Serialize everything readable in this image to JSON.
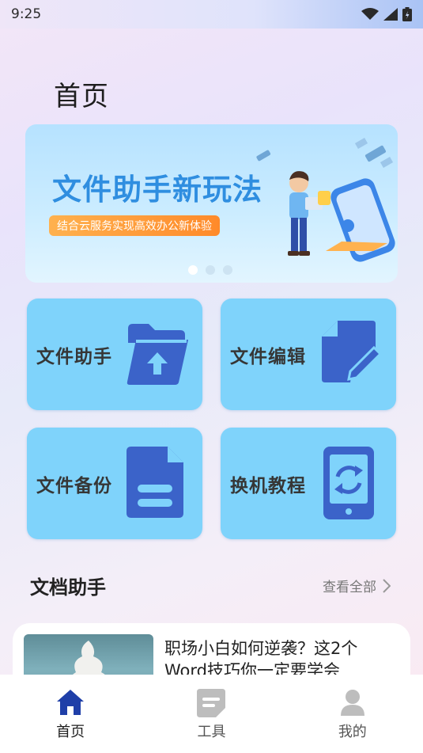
{
  "status_bar": {
    "time": "9:25"
  },
  "page": {
    "title": "首页"
  },
  "banner": {
    "title": "文件助手新玩法",
    "subtitle": "结合云服务实现高效办公新体验",
    "dots": 3,
    "active_dot": 0
  },
  "feature_cards": [
    {
      "label": "文件助手",
      "icon": "folder-upload-icon"
    },
    {
      "label": "文件编辑",
      "icon": "document-edit-icon"
    },
    {
      "label": "文件备份",
      "icon": "document-backup-icon"
    },
    {
      "label": "换机教程",
      "icon": "phone-sync-icon"
    }
  ],
  "section": {
    "title": "文档助手",
    "view_all": "查看全部"
  },
  "article": {
    "title": "职场小白如何逆袭？这2个Word技巧你一定要学会"
  },
  "tab_bar": {
    "tabs": [
      {
        "label": "首页",
        "icon": "home-icon",
        "active": true
      },
      {
        "label": "工具",
        "icon": "tools-icon",
        "active": false
      },
      {
        "label": "我的",
        "icon": "profile-icon",
        "active": false
      }
    ]
  },
  "colors": {
    "card_bg": "#7fd3fb",
    "icon_blue": "#3b63c9",
    "tab_active": "#1f3fa8",
    "tab_inactive": "#bdbdbd",
    "banner_title": "#2f8ee0",
    "banner_sub_bg": "#ff8a2a"
  }
}
